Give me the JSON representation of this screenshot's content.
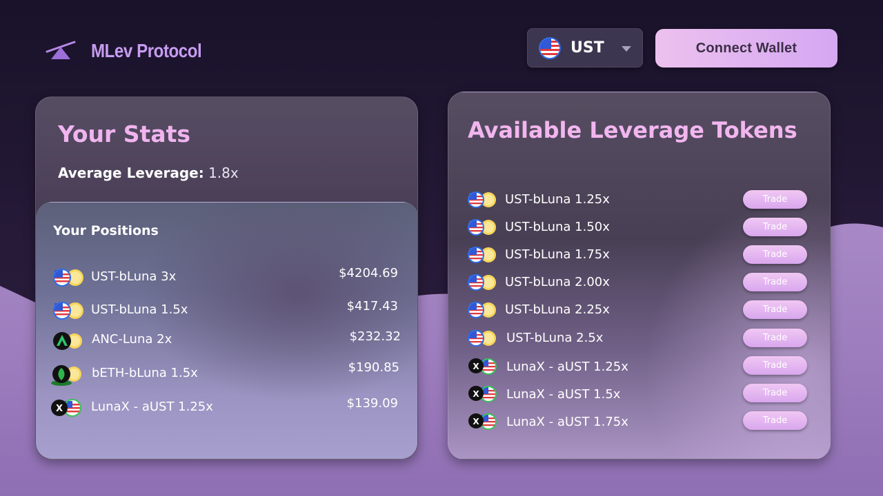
{
  "header": {
    "app_name": "MLev Protocol",
    "currency_label": "UST",
    "connect_label": "Connect Wallet"
  },
  "stats": {
    "title": "Your Stats",
    "avg_leverage_label": "Average Leverage:",
    "avg_leverage_value": "1.8x"
  },
  "positions": {
    "title": "Your Positions",
    "items": [
      {
        "name": "UST-bLuna 3x",
        "value": "$4204.69",
        "icon_a": "ust-flag-icon",
        "icon_b": "luna-coin-icon"
      },
      {
        "name": "UST-bLuna 1.5x",
        "value": "$417.43",
        "icon_a": "ust-flag-icon",
        "icon_b": "luna-coin-icon"
      },
      {
        "name": "ANC-Luna 2x",
        "value": "$232.32",
        "icon_a": "anc-icon",
        "icon_b": "luna-coin-icon"
      },
      {
        "name": "bETH-bLuna 1.5x",
        "value": "$190.85",
        "icon_a": "beth-icon",
        "icon_b": "luna-coin-icon"
      },
      {
        "name": "LunaX - aUST 1.25x",
        "value": "$139.09",
        "icon_a": "lunax-icon",
        "icon_b": "aust-icon"
      }
    ]
  },
  "tokens": {
    "title": "Available Leverage Tokens",
    "trade_label": "Trade",
    "items": [
      {
        "name": "UST-bLuna 1.25x",
        "icon_a": "ust-flag-icon",
        "icon_b": "luna-coin-icon"
      },
      {
        "name": "UST-bLuna 1.50x",
        "icon_a": "ust-flag-icon",
        "icon_b": "luna-coin-icon"
      },
      {
        "name": "UST-bLuna 1.75x",
        "icon_a": "ust-flag-icon",
        "icon_b": "luna-coin-icon"
      },
      {
        "name": "UST-bLuna 2.00x",
        "icon_a": "ust-flag-icon",
        "icon_b": "luna-coin-icon"
      },
      {
        "name": "UST-bLuna 2.25x",
        "icon_a": "ust-flag-icon",
        "icon_b": "luna-coin-icon"
      },
      {
        "name": "UST-bLuna 2.5x",
        "icon_a": "ust-flag-icon",
        "icon_b": "luna-coin-icon"
      },
      {
        "name": "LunaX - aUST 1.25x",
        "icon_a": "lunax-icon",
        "icon_b": "aust-icon"
      },
      {
        "name": "LunaX - aUST 1.5x",
        "icon_a": "lunax-icon",
        "icon_b": "aust-icon"
      },
      {
        "name": "LunaX - aUST 1.75x",
        "icon_a": "lunax-icon",
        "icon_b": "aust-icon"
      }
    ]
  },
  "colors": {
    "background_dark": "#1d1530",
    "background_wave": "#9b7fbd",
    "accent_pink": "#f0b4ef",
    "accent_purple": "#c79cf1",
    "luna_yellow": "#f6d65a"
  }
}
